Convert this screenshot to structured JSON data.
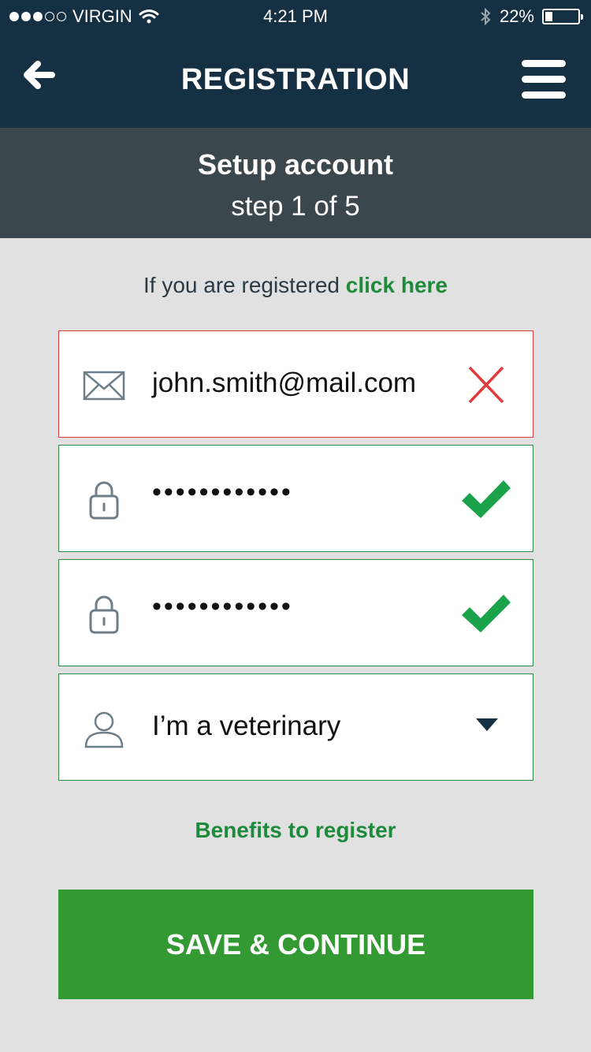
{
  "status_bar": {
    "carrier": "VIRGIN",
    "signal_bars": 3,
    "time": "4:21 PM",
    "battery": "22%",
    "battery_level": 0.22
  },
  "nav": {
    "title": "REGISTRATION",
    "back_icon": "arrow-left-icon",
    "menu_icon": "hamburger-menu-icon"
  },
  "step": {
    "title": "Setup account",
    "subtitle": "step 1 of 5"
  },
  "login_prompt": {
    "text": "If you are registered ",
    "link": "click here"
  },
  "form": {
    "email": {
      "value": "john.smith@mail.com",
      "icon": "envelope-icon",
      "status": "invalid",
      "status_icon": "x-icon"
    },
    "password": {
      "value": "••••••••••••",
      "icon": "lock-icon",
      "status": "valid",
      "status_icon": "checkmark-icon"
    },
    "confirm_password": {
      "value": "••••••••••••",
      "icon": "lock-icon",
      "status": "valid",
      "status_icon": "checkmark-icon"
    },
    "role": {
      "value": "I’m a veterinary",
      "icon": "user-icon",
      "dropdown_icon": "caret-down-icon"
    }
  },
  "benefits_link": "Benefits to register",
  "save_button": "SAVE & CONTINUE",
  "colors": {
    "nav_bg": "#163043",
    "step_bg": "#3c464d",
    "page_bg": "#e1e1e1",
    "accent_green": "#1e8a3c",
    "button_green": "#339933",
    "error_red": "#e03a3a"
  }
}
